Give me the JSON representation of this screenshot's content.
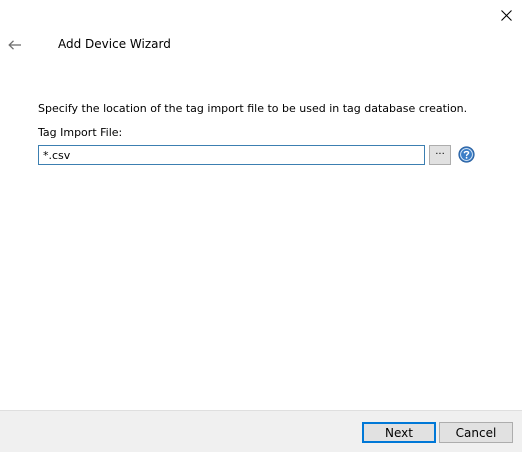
{
  "window": {
    "title": "Add Device Wizard",
    "close_icon": "close-icon",
    "back_icon": "back-arrow-icon"
  },
  "content": {
    "instruction": "Specify the location of the tag import file to be used in tag database creation.",
    "field_label": "Tag Import File:",
    "field_value": "*.csv",
    "browse_label": "...",
    "help_icon": "help-icon"
  },
  "footer": {
    "next_label": "Next",
    "cancel_label": "Cancel"
  },
  "colors": {
    "accent": "#0078d7",
    "input_border": "#3c7fb1",
    "help_icon": "#3b7ec7",
    "footer_bg": "#f0f0f0"
  }
}
